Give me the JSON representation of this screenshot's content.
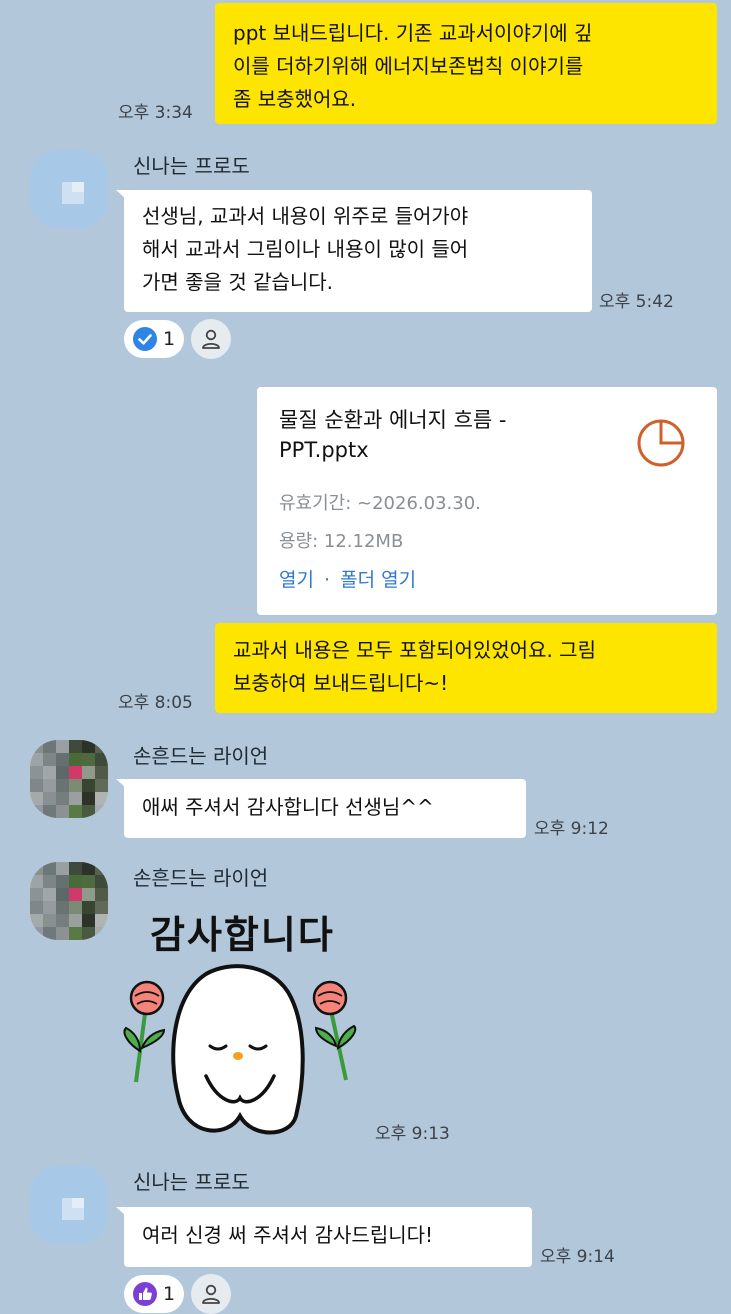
{
  "messages": {
    "m1": {
      "text": "ppt 보내드립니다. 기존 교과서이야기에 깊\n이를 더하기위해 에너지보존법칙 이야기를\n좀 보충했어요.",
      "time": "오후 3:34"
    },
    "m2": {
      "sender": "신나는 프로도",
      "text": "선생님, 교과서 내용이 위주로 들어가야\n해서 교과서 그림이나 내용이 많이 들어\n가면 좋을 것 같습니다.",
      "time": "오후 5:42",
      "reaction_count": "1"
    },
    "m3": {
      "file_name": "물질 순환과 에너지 흐름 -\n PPT.pptx",
      "validity": "유효기간: ~2026.03.30.",
      "size": "용량: 12.12MB",
      "open_label": "열기",
      "separator": "·",
      "folder_label": "폴더 열기"
    },
    "m4": {
      "text": "교과서 내용은 모두 포함되어있었어요. 그림\n 보충하여 보내드립니다~!",
      "time": "오후 8:05"
    },
    "m5": {
      "sender": "손흔드는 라이언",
      "text": "애써 주셔서 감사합니다 선생님^^",
      "time": "오후 9:12"
    },
    "m6": {
      "sender": "손흔드는 라이언",
      "sticker_text": "감사합니다",
      "time": "오후 9:13"
    },
    "m7": {
      "sender": "신나는 프로도",
      "text": "여러 신경 써 주셔서 감사드립니다!",
      "time": "오후 9:14",
      "reaction_count": "1"
    }
  },
  "icons": {
    "check_reaction": "check-circle-icon",
    "thumb_reaction": "thumbs-up-icon",
    "person": "person-icon",
    "file_type": "pie-chart-file-icon"
  },
  "colors": {
    "background": "#b2c7da",
    "my_bubble": "#fee500",
    "their_bubble": "#ffffff",
    "link": "#2f7ad0",
    "file_icon": "#d0602a"
  }
}
